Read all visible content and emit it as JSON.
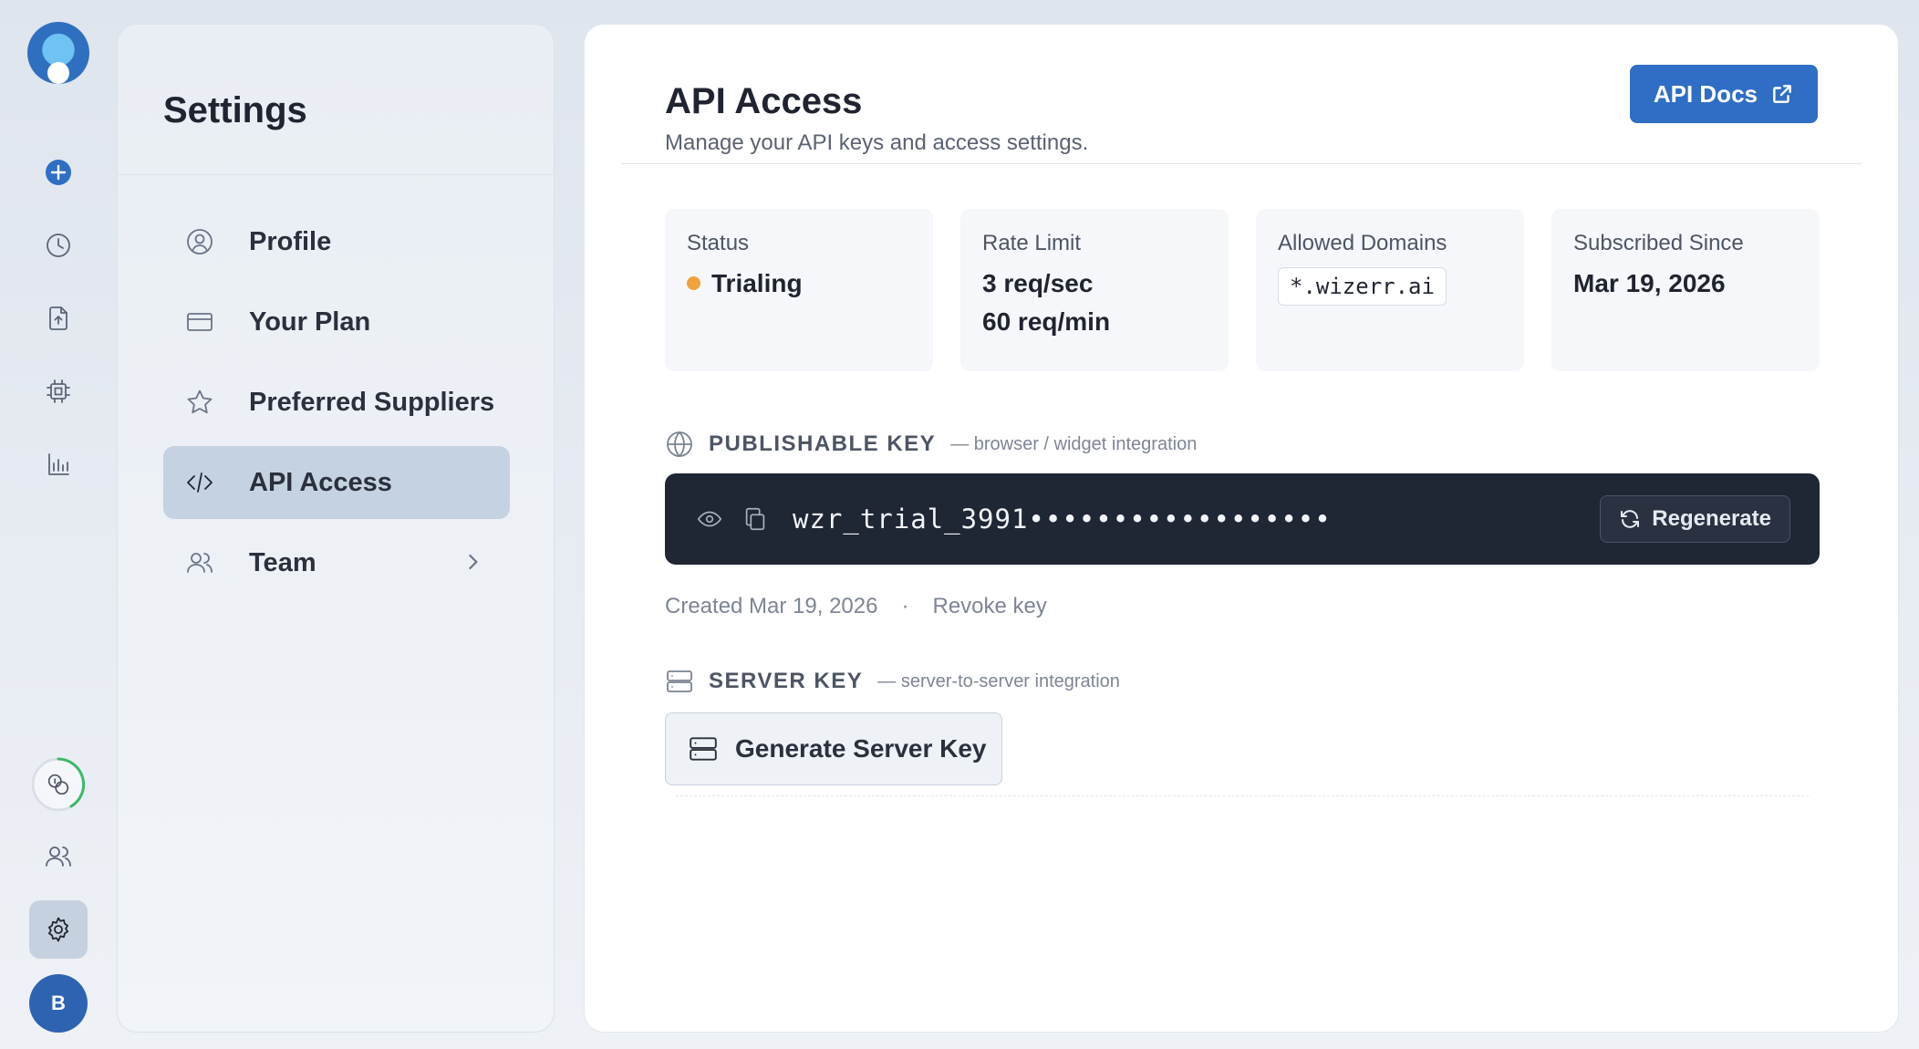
{
  "rail": {
    "icons": [
      "logo-icon",
      "plus-icon",
      "clock-icon",
      "file-upload-icon",
      "chip-icon",
      "bar-chart-icon",
      "credits-icon",
      "users-icon",
      "gear-icon"
    ],
    "avatar_initial": "B",
    "accent": "#2f6ec4"
  },
  "settings": {
    "title": "Settings",
    "items": [
      {
        "label": "Profile",
        "icon": "user-circle-icon"
      },
      {
        "label": "Your Plan",
        "icon": "credit-card-icon"
      },
      {
        "label": "Preferred Suppliers",
        "icon": "star-icon"
      },
      {
        "label": "API Access",
        "icon": "code-icon",
        "active": true
      },
      {
        "label": "Team",
        "icon": "users-icon",
        "has_chevron": true
      }
    ]
  },
  "header": {
    "title": "API Access",
    "subtitle": "Manage your API keys and access settings.",
    "docs_button": "API Docs"
  },
  "stats": {
    "status": {
      "label": "Status",
      "value": "Trialing",
      "dot_color": "#f0a23b"
    },
    "rate_limit": {
      "label": "Rate Limit",
      "line1": "3 req/sec",
      "line2": "60 req/min"
    },
    "allowed_domains": {
      "label": "Allowed Domains",
      "value": "*.wizerr.ai"
    },
    "subscribed_since": {
      "label": "Subscribed Since",
      "value": "Mar 19, 2026"
    }
  },
  "publishable_key": {
    "title": "PUBLISHABLE KEY",
    "note": "— browser / widget integration",
    "key": "wzr_trial_3991••••••••••••••••••",
    "regenerate_label": "Regenerate",
    "created": "Created Mar 19, 2026",
    "separator": "·",
    "revoke_label": "Revoke key"
  },
  "server_key": {
    "title": "SERVER KEY",
    "note": "— server-to-server integration",
    "generate_label": "Generate Server Key"
  }
}
